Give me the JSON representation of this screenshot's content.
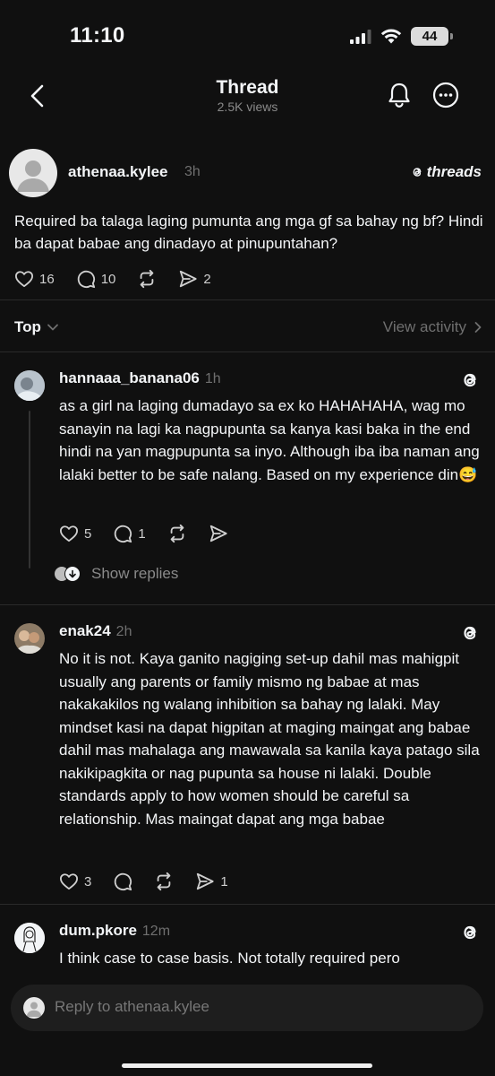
{
  "status": {
    "time": "11:10",
    "battery": "44"
  },
  "header": {
    "title": "Thread",
    "views": "2.5K views"
  },
  "post": {
    "username": "athenaa.kylee",
    "time": "3h",
    "brand": "threads",
    "text": "Required ba talaga laging pumunta ang mga gf sa bahay ng bf? Hindi ba dapat babae ang dinadayo at pinupuntahan?",
    "likes": "16",
    "comments": "10",
    "shares": "2"
  },
  "filter": {
    "sort_label": "Top",
    "activity_label": "View activity"
  },
  "replies": [
    {
      "username": "hannaaa_banana06",
      "time": "1h",
      "text": "as a girl na laging dumadayo sa ex ko HAHAHAHA, wag mo sanayin na lagi ka nagpupunta sa kanya kasi baka in the end hindi na yan magpupunta sa inyo. Although iba iba naman ang lalaki better to be safe nalang. Based on my experience din😅",
      "likes": "5",
      "comments": "1",
      "show_replies": "Show replies"
    },
    {
      "username": "enak24",
      "time": "2h",
      "text": "No it is not. Kaya ganito nagiging set-up dahil mas mahigpit usually ang parents or family mismo ng babae at mas nakakakilos ng walang inhibition sa bahay ng lalaki. May mindset kasi na dapat higpitan at maging maingat ang babae dahil mas mahalaga ang mawawala sa kanila kaya patago sila nakikipagkita or nag pupunta sa house ni lalaki. Double standards apply to how women should be careful sa relationship. Mas maingat dapat ang mga babae",
      "likes": "3",
      "shares": "1"
    },
    {
      "username": "dum.pkore",
      "time": "12m",
      "text": "I think case to case basis. Not totally required pero"
    }
  ],
  "reply_bar": {
    "placeholder": "Reply to athenaa.kylee"
  },
  "colors": {
    "background": "#101010",
    "text": "#f3f5f7",
    "muted": "#6f6f6f"
  }
}
